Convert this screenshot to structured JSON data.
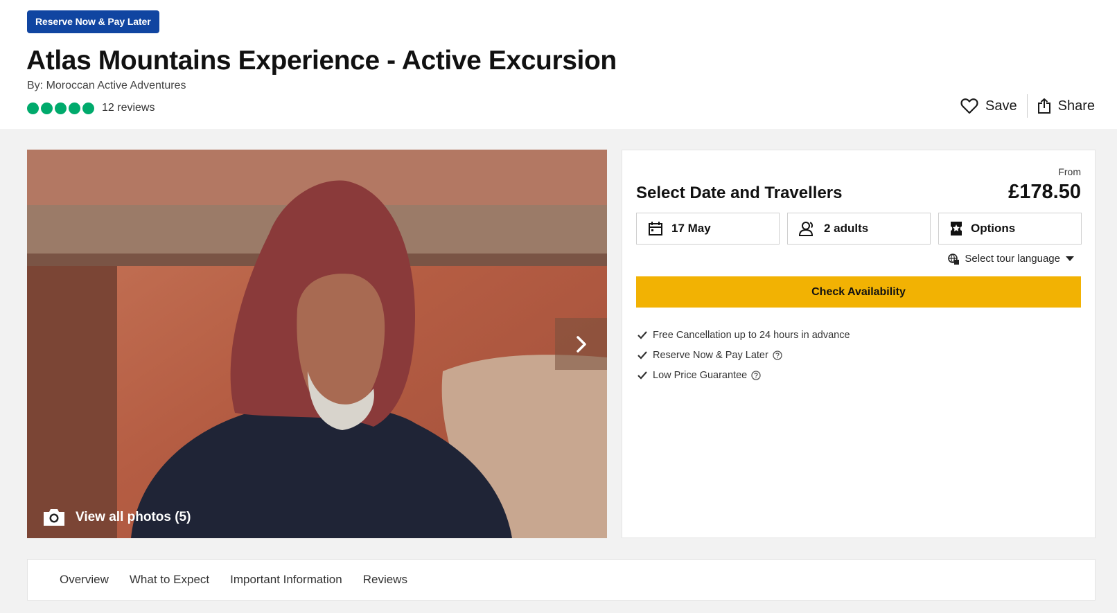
{
  "header": {
    "badge": "Reserve Now & Pay Later",
    "title": "Atlas Mountains Experience - Active Excursion",
    "byline": "By: Moroccan Active Adventures",
    "rating_bubbles": 5,
    "reviews": "12 reviews",
    "save_label": "Save",
    "share_label": "Share"
  },
  "gallery": {
    "view_photos": "View all photos (5)"
  },
  "booking": {
    "from_label": "From",
    "price": "£178.50",
    "title": "Select Date and Travellers",
    "date": "17 May",
    "travellers": "2 adults",
    "options": "Options",
    "language": "Select tour language",
    "check_button": "Check Availability",
    "benefits": [
      "Free Cancellation up to 24 hours in advance",
      "Reserve Now & Pay Later",
      "Low Price Guarantee"
    ]
  },
  "tabs": [
    "Overview",
    "What to Expect",
    "Important Information",
    "Reviews"
  ],
  "colors": {
    "badge": "#1045a1",
    "rating": "#00aa6c",
    "check_button": "#f2b203"
  }
}
